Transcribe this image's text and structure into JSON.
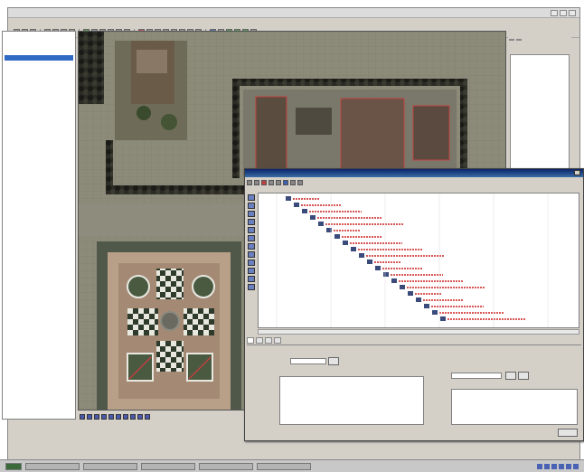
{
  "window": {
    "title": ""
  },
  "menubar": {
    "items": []
  },
  "tree": {
    "items": [
      {
        "label": ""
      },
      {
        "label": ""
      },
      {
        "label": ""
      },
      {
        "label": ""
      },
      {
        "label": ""
      },
      {
        "label": ""
      },
      {
        "label": ""
      },
      {
        "label": ""
      },
      {
        "label": ""
      },
      {
        "label": ""
      },
      {
        "label": ""
      },
      {
        "label": ""
      },
      {
        "label": ""
      },
      {
        "label": ""
      },
      {
        "label": ""
      },
      {
        "label": ""
      },
      {
        "label": ""
      },
      {
        "label": ""
      },
      {
        "label": ""
      },
      {
        "label": ""
      }
    ],
    "selected_index": 4
  },
  "right_panel": {
    "header": "",
    "tabs": [
      "",
      ""
    ],
    "items": [
      "",
      "",
      ""
    ]
  },
  "dialog": {
    "title": "",
    "menu": "",
    "tabs": [
      "",
      "",
      "",
      ""
    ],
    "active_tab": 0,
    "rows": 20
  },
  "colors": {
    "app_bg": "#d4d0c8",
    "map_grass": "#8a8878",
    "hedge": "#2a2a24",
    "path": "#b4a88c",
    "dialog_title": "#0a246a",
    "grid_red_text": "#cc2020",
    "grid_diag_block": "#3a4a7a",
    "selection": "#316ac5"
  },
  "status": {
    "text": ""
  },
  "taskbar": {
    "items": [
      "",
      "",
      "",
      "",
      ""
    ]
  }
}
